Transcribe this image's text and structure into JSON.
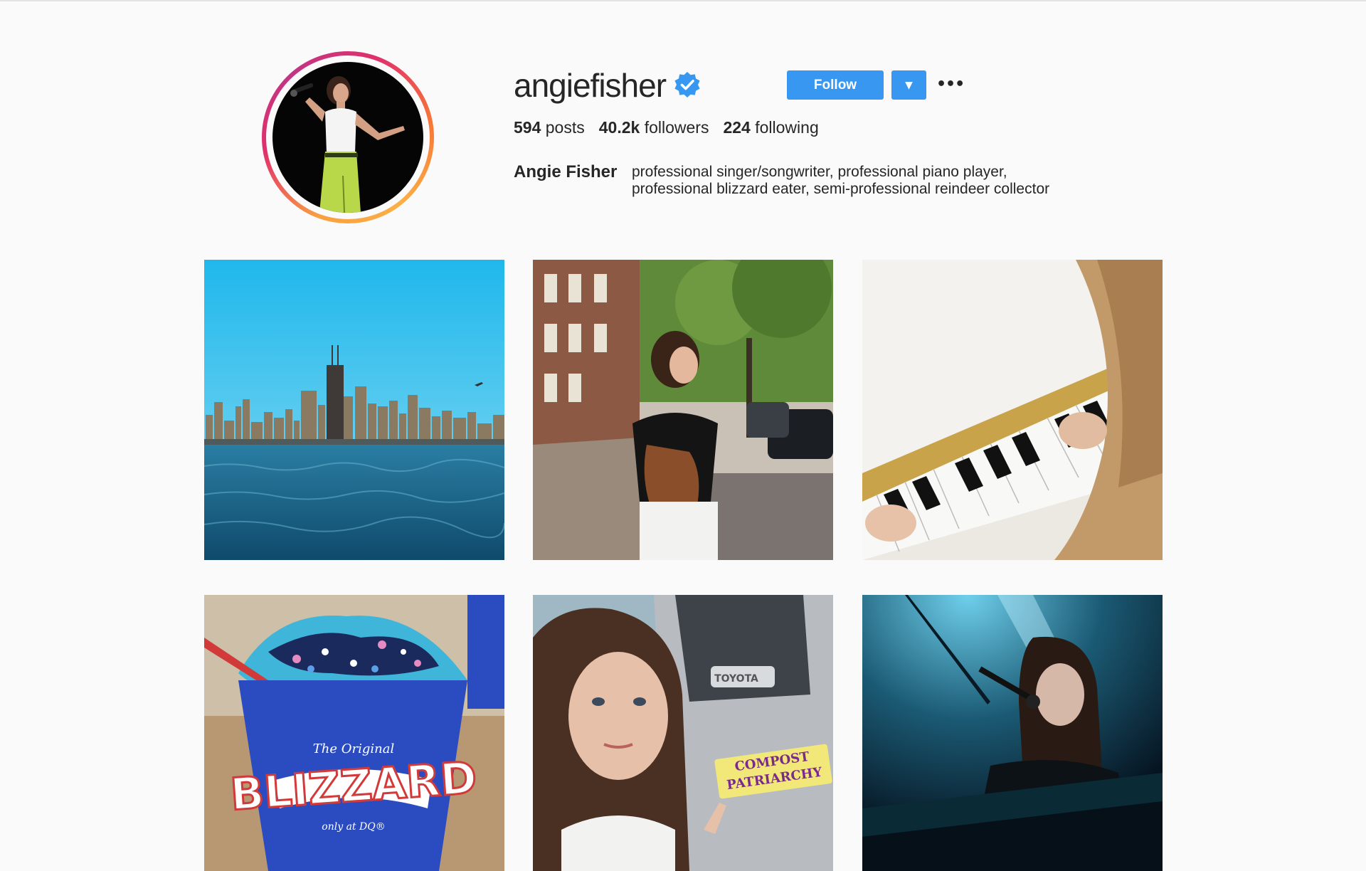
{
  "profile": {
    "username": "angiefisher",
    "verified": true,
    "full_name": "Angie Fisher",
    "bio_lines": [
      "professional singer/songwriter, professional piano player,",
      "professional blizzard eater, semi-professional reindeer collector"
    ]
  },
  "actions": {
    "follow_label": "Follow",
    "dropdown_glyph": "▼",
    "more_glyph": "•••"
  },
  "stats": {
    "posts_count": "594",
    "posts_label": "posts",
    "followers_count": "40.2k",
    "followers_label": "followers",
    "following_count": "224",
    "following_label": "following"
  },
  "photo5": {
    "car_brand": "TOYOTA",
    "sticker_line1": "COMPOST",
    "sticker_line2": "PATRIARCHY"
  },
  "photo4": {
    "cup_top": "The Original",
    "cup_brand": "BLIZZARD",
    "cup_bottom": "only at DQ®"
  },
  "icons": {
    "verified": "verified-badge-icon",
    "more": "more-options-icon",
    "dropdown": "chevron-down-icon"
  },
  "colors": {
    "accent_blue": "#3897f0",
    "verified_blue": "#3897f0",
    "background": "#fafafa"
  }
}
